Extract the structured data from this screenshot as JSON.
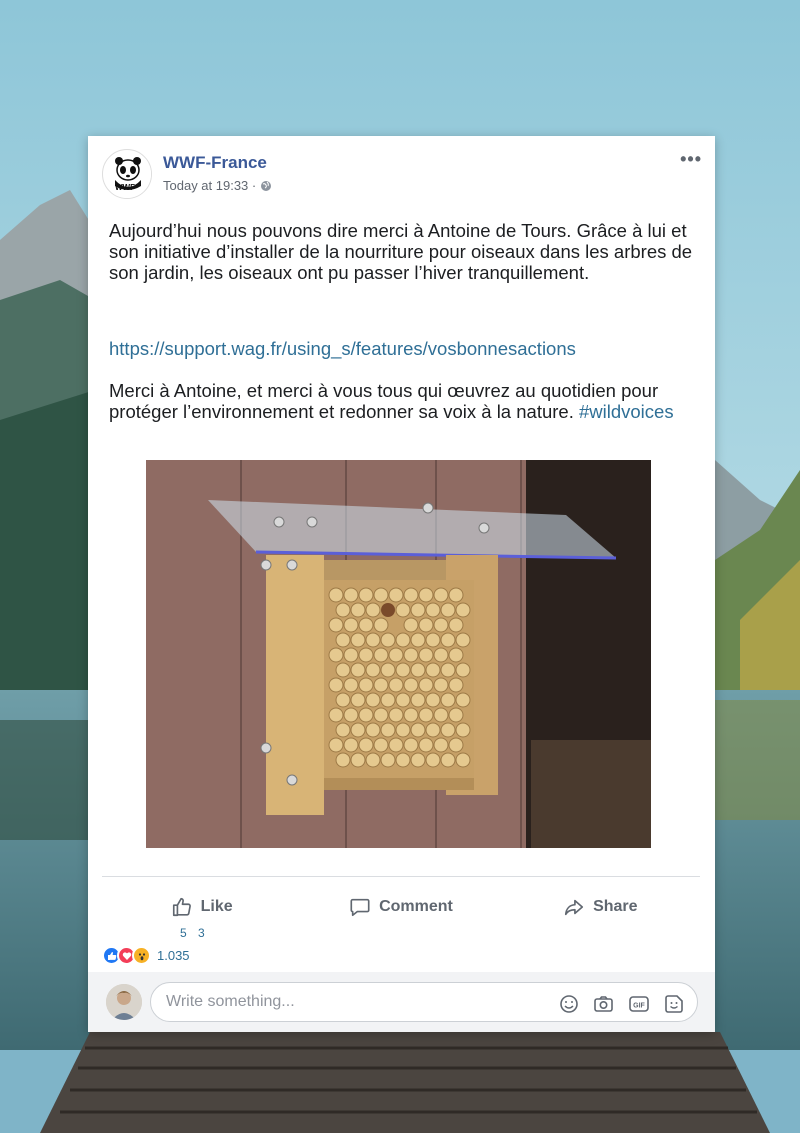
{
  "post": {
    "page_name": "WWF-France",
    "timestamp": "Today at 19:33 ·",
    "more_label": "•••",
    "text_p1": "Aujourd’hui nous pouvons dire merci à Antoine de Tours. Grâce à lui et son initiative d’installer de la nourriture pour oiseaux dans les arbres de son jardin, les oiseaux ont pu passer l’hiver tranquillement.",
    "link": "https://support.wag.fr/using_s/features/vosbonnesactions",
    "text_p3": "Merci à Antoine, et merci à vous tous qui œuvrez au quotidien pour protéger l’environnement et redonner sa voix à la nature.",
    "hashtag": "#wildvoices",
    "avatar_text": "WWF"
  },
  "actions": {
    "like": "Like",
    "comment": "Comment",
    "share": "Share"
  },
  "counts": {
    "small": "5 3",
    "reactions": "1.035",
    "reaction_icons": [
      "like-icon",
      "love-icon",
      "wow-icon"
    ]
  },
  "composer": {
    "placeholder": "Write something...",
    "icons": [
      "emoji-icon",
      "camera-icon",
      "gif-icon",
      "sticker-icon"
    ]
  },
  "colors": {
    "brand": "#3b5998",
    "link": "#2f6f96",
    "like": "#2078f4",
    "love": "#f33e58",
    "wow": "#f7b125"
  }
}
